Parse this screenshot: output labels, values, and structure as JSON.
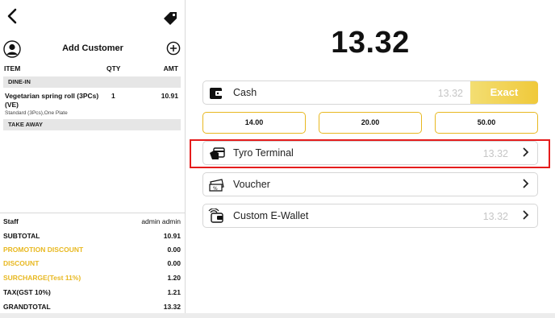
{
  "left_panel": {
    "add_customer": "Add Customer",
    "columns": {
      "item": "ITEM",
      "qty": "QTY",
      "amt": "AMT"
    },
    "sections": {
      "dine_in": "DINE-IN",
      "take_away": "TAKE AWAY"
    },
    "order_item": {
      "name": "Vegetarian spring roll (3PCs) (VE)",
      "modifiers": "Standard (3Pcs),One Plate",
      "qty": "1",
      "amount": "10.91"
    },
    "totals": {
      "staff_label": "Staff",
      "staff_value": "admin admin",
      "subtotal_label": "SUBTOTAL",
      "subtotal_value": "10.91",
      "promotion_discount_label": "PROMOTION DISCOUNT",
      "promotion_discount_value": "0.00",
      "discount_label": "DISCOUNT",
      "discount_value": "0.00",
      "surcharge_label": "SURCHARGE(Test 11%)",
      "surcharge_value": "1.20",
      "tax_label": "TAX(GST 10%)",
      "tax_value": "1.21",
      "grandtotal_label": "GRANDTOTAL",
      "grandtotal_value": "13.32"
    }
  },
  "payment": {
    "amount_due": "13.32",
    "cash": {
      "label": "Cash",
      "amount": "13.32",
      "exact_label": "Exact"
    },
    "quick_amounts": [
      "14.00",
      "20.00",
      "50.00"
    ],
    "methods": [
      {
        "label": "Tyro Terminal",
        "amount": "13.32",
        "icon": "card-terminal-icon"
      },
      {
        "label": "Voucher",
        "amount": "",
        "icon": "voucher-icon"
      },
      {
        "label": "Custom E-Wallet",
        "amount": "13.32",
        "icon": "e-wallet-icon"
      }
    ]
  },
  "colors": {
    "accent_gold": "#e8b820",
    "highlight_red": "#e51c1c"
  }
}
